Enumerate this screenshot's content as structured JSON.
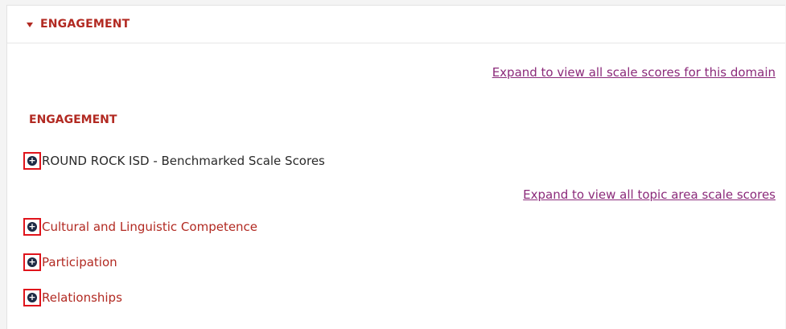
{
  "panel": {
    "header_title": "ENGAGEMENT",
    "expand_domain_link": "Expand to view all scale scores for this domain",
    "section_title": "ENGAGEMENT",
    "benchmark_label": "ROUND ROCK ISD - Benchmarked Scale Scores",
    "expand_topic_link": "Expand to view all topic area scale scores",
    "topics": [
      {
        "label": "Cultural and Linguistic Competence"
      },
      {
        "label": "Participation"
      },
      {
        "label": "Relationships"
      }
    ],
    "expand_icon": "plus-circle-icon",
    "accent_color": "#b22a22",
    "link_color": "#8b2a7a",
    "highlight_box_color": "#e0141c"
  }
}
